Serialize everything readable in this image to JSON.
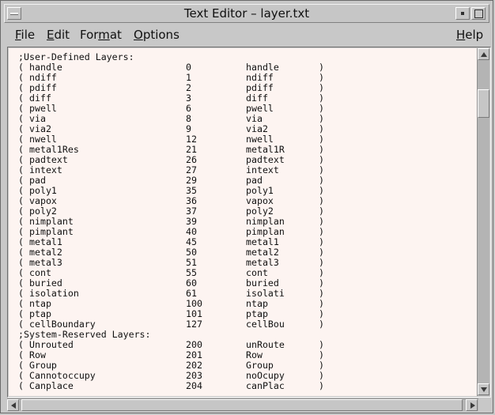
{
  "window": {
    "title": "Text Editor – layer.txt"
  },
  "menu": {
    "file": {
      "first": "F",
      "rest": "ile"
    },
    "edit": {
      "first": "E",
      "rest": "dit"
    },
    "format": {
      "pre": "For",
      "u": "m",
      "post": "at"
    },
    "options": {
      "first": "O",
      "rest": "ptions"
    },
    "help": {
      "first": "H",
      "rest": "elp"
    }
  },
  "sections": [
    {
      "heading": ";User-Defined Layers:",
      "rows": [
        {
          "name": "handle",
          "num": "0",
          "abbr": "handle"
        },
        {
          "name": "ndiff",
          "num": "1",
          "abbr": "ndiff"
        },
        {
          "name": "pdiff",
          "num": "2",
          "abbr": "pdiff"
        },
        {
          "name": "diff",
          "num": "3",
          "abbr": "diff"
        },
        {
          "name": "pwell",
          "num": "6",
          "abbr": "pwell"
        },
        {
          "name": "via",
          "num": "8",
          "abbr": "via"
        },
        {
          "name": "via2",
          "num": "9",
          "abbr": "via2"
        },
        {
          "name": "nwell",
          "num": "12",
          "abbr": "nwell"
        },
        {
          "name": "metal1Res",
          "num": "21",
          "abbr": "metal1R"
        },
        {
          "name": "padtext",
          "num": "26",
          "abbr": "padtext"
        },
        {
          "name": "intext",
          "num": "27",
          "abbr": "intext"
        },
        {
          "name": "pad",
          "num": "29",
          "abbr": "pad"
        },
        {
          "name": "poly1",
          "num": "35",
          "abbr": "poly1"
        },
        {
          "name": "vapox",
          "num": "36",
          "abbr": "vapox"
        },
        {
          "name": "poly2",
          "num": "37",
          "abbr": "poly2"
        },
        {
          "name": "nimplant",
          "num": "39",
          "abbr": "nimplan"
        },
        {
          "name": "pimplant",
          "num": "40",
          "abbr": "pimplan"
        },
        {
          "name": "metal1",
          "num": "45",
          "abbr": "metal1"
        },
        {
          "name": "metal2",
          "num": "50",
          "abbr": "metal2"
        },
        {
          "name": "metal3",
          "num": "51",
          "abbr": "metal3"
        },
        {
          "name": "cont",
          "num": "55",
          "abbr": "cont"
        },
        {
          "name": "buried",
          "num": "60",
          "abbr": "buried"
        },
        {
          "name": "isolation",
          "num": "61",
          "abbr": "isolati"
        },
        {
          "name": "ntap",
          "num": "100",
          "abbr": "ntap"
        },
        {
          "name": "ptap",
          "num": "101",
          "abbr": "ptap"
        },
        {
          "name": "cellBoundary",
          "num": "127",
          "abbr": "cellBou"
        }
      ]
    },
    {
      "heading": ";System-Reserved Layers:",
      "rows": [
        {
          "name": "Unrouted",
          "num": "200",
          "abbr": "unRoute"
        },
        {
          "name": "Row",
          "num": "201",
          "abbr": "Row"
        },
        {
          "name": "Group",
          "num": "202",
          "abbr": "Group"
        },
        {
          "name": "Cannotoccupy",
          "num": "203",
          "abbr": "noOcupy"
        },
        {
          "name": "Canplace",
          "num": "204",
          "abbr": "canPlac"
        }
      ]
    }
  ],
  "syntax": {
    "open": "(",
    "close": ")"
  },
  "colors": {
    "text_background": "#fdf4f1",
    "chrome": "#c8c8c8",
    "scroll_trough": "#b4b4b4"
  }
}
